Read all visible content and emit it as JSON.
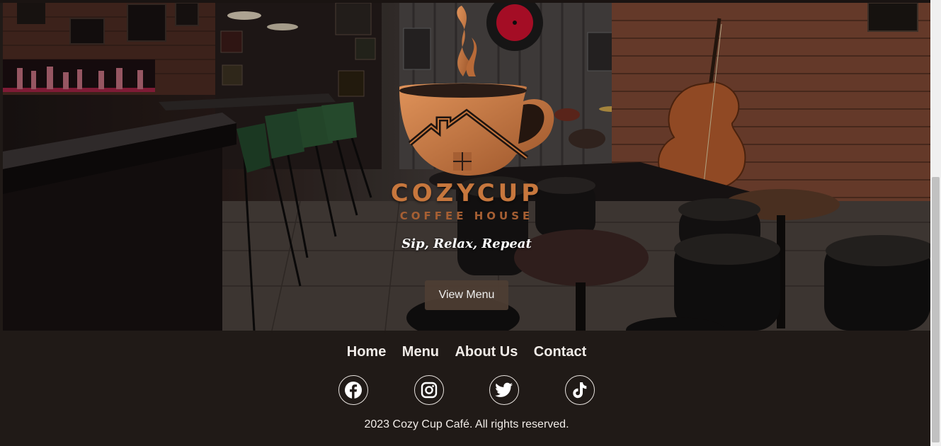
{
  "hero": {
    "brand_name": "COZYCUP",
    "brand_sub": "COFFEE HOUSE",
    "tagline": "Sip, Relax, Repeat",
    "cta_label": "View Menu"
  },
  "nav": {
    "items": [
      {
        "label": "Home"
      },
      {
        "label": "Menu"
      },
      {
        "label": "About Us"
      },
      {
        "label": "Contact"
      }
    ]
  },
  "socials": [
    {
      "icon": "facebook-icon"
    },
    {
      "icon": "instagram-icon"
    },
    {
      "icon": "twitter-icon"
    },
    {
      "icon": "tiktok-icon"
    }
  ],
  "footer": {
    "copyright": "2023 Cozy Cup Café. All rights reserved."
  },
  "colors": {
    "footer_bg": "#201a17",
    "accent_copper": "#c7773d",
    "button_bg": "#4e3e34",
    "text_light": "#f1ece8"
  }
}
